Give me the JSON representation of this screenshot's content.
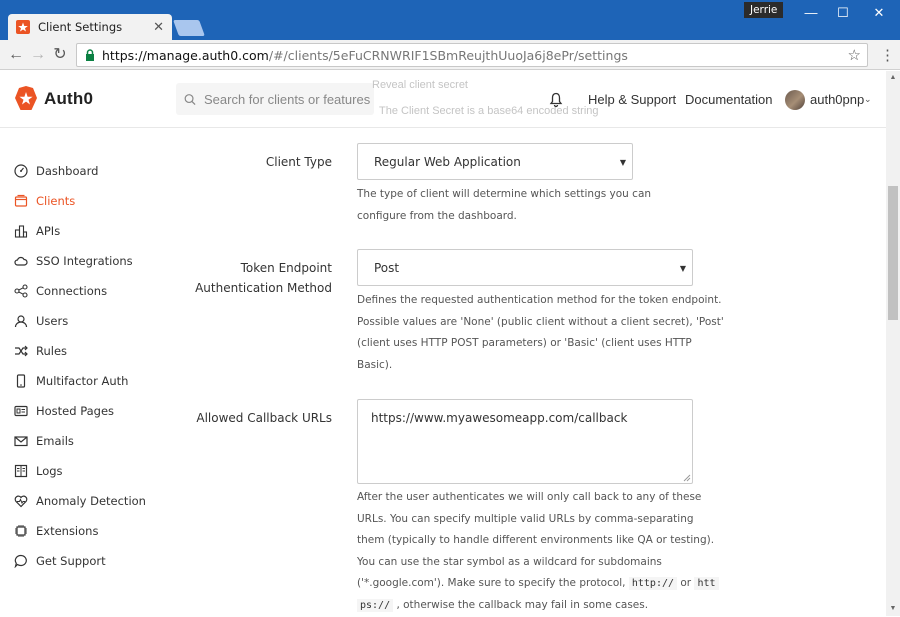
{
  "browser": {
    "tab_title": "Client Settings",
    "tab_close": "✕",
    "user_chip": "Jerrie",
    "url_host": "https://manage.auth0.com",
    "url_rest": "/#/clients/5eFuCRNWRIF1SBmReujthUuoJa6j8ePr/settings",
    "window_minimize": "—",
    "window_maximize": "☐",
    "window_close": "✕"
  },
  "header": {
    "logo_text": "Auth0",
    "search_placeholder": "Search for clients or features",
    "ghost_reveal": "Reveal client secret",
    "ghost_secret_note": "The Client Secret is a base64 encoded string",
    "help_support": "Help & Support",
    "documentation": "Documentation",
    "username": "auth0pnp"
  },
  "sidebar": {
    "items": [
      {
        "label": "Dashboard",
        "icon": "dashboard-icon"
      },
      {
        "label": "Clients",
        "icon": "clients-icon",
        "active": true
      },
      {
        "label": "APIs",
        "icon": "apis-icon"
      },
      {
        "label": "SSO Integrations",
        "icon": "cloud-icon"
      },
      {
        "label": "Connections",
        "icon": "connections-icon"
      },
      {
        "label": "Users",
        "icon": "users-icon"
      },
      {
        "label": "Rules",
        "icon": "rules-icon"
      },
      {
        "label": "Multifactor Auth",
        "icon": "phone-icon"
      },
      {
        "label": "Hosted Pages",
        "icon": "hosted-pages-icon"
      },
      {
        "label": "Emails",
        "icon": "email-icon"
      },
      {
        "label": "Logs",
        "icon": "logs-icon"
      },
      {
        "label": "Anomaly Detection",
        "icon": "heart-icon"
      },
      {
        "label": "Extensions",
        "icon": "chip-icon"
      },
      {
        "label": "Get Support",
        "icon": "chat-icon"
      }
    ]
  },
  "form": {
    "client_type": {
      "label": "Client Type",
      "value": "Regular Web Application",
      "help_lines": [
        "The type of client will determine which settings you can",
        "configure from the dashboard."
      ]
    },
    "token_endpoint": {
      "label_line1": "Token Endpoint",
      "label_line2": "Authentication Method",
      "value": "Post",
      "help_lines": [
        "Defines the requested authentication method for the token endpoint.",
        "Possible values are 'None' (public client without a client secret), 'Post'",
        "(client uses HTTP POST parameters) or 'Basic' (client uses HTTP",
        "Basic)."
      ]
    },
    "callback_urls": {
      "label": "Allowed Callback URLs",
      "value": "https://www.myawesomeapp.com/callback",
      "help_lines": [
        "After the user authenticates we will only call back to any of these",
        "URLs. You can specify multiple valid URLs by comma-separating",
        "them (typically to handle different environments like QA or testing).",
        "You can use the star symbol as a wildcard for subdomains"
      ],
      "help_line5_pre": "('*.google.com'). Make sure to specify the protocol,",
      "code_http": "http://",
      "or_text": "or",
      "code_https_a": "htt",
      "code_https_b": "ps://",
      "help_line6_post": ", otherwise the callback may fail in some cases."
    }
  },
  "colors": {
    "brand": "#eb5424",
    "chrome_blue": "#1e64b7"
  }
}
